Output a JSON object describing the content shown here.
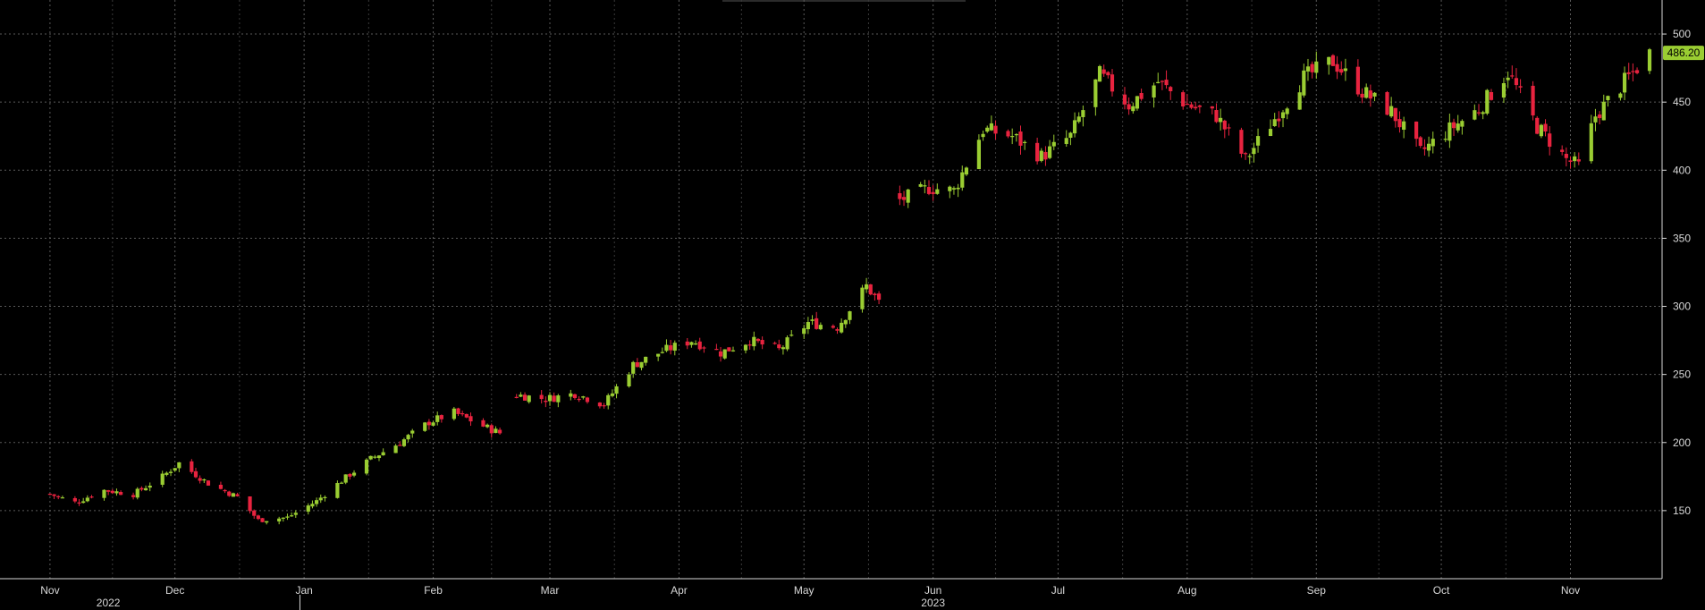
{
  "chart_data": {
    "type": "candlestick",
    "title": "",
    "xlabel": "",
    "ylabel": "",
    "grid": true,
    "legend": "none",
    "ylim": [
      100,
      525
    ],
    "y_ticks": [
      150,
      200,
      250,
      300,
      350,
      400,
      450,
      500
    ],
    "x_month_labels": [
      {
        "label": "Nov",
        "date": "2022-11-01"
      },
      {
        "label": "Dec",
        "date": "2022-12-01"
      },
      {
        "label": "Jan",
        "date": "2023-01-01"
      },
      {
        "label": "Feb",
        "date": "2023-02-01"
      },
      {
        "label": "Mar",
        "date": "2023-03-01"
      },
      {
        "label": "Apr",
        "date": "2023-04-01"
      },
      {
        "label": "May",
        "date": "2023-05-01"
      },
      {
        "label": "Jun",
        "date": "2023-06-01"
      },
      {
        "label": "Jul",
        "date": "2023-07-01"
      },
      {
        "label": "Aug",
        "date": "2023-08-01"
      },
      {
        "label": "Sep",
        "date": "2023-09-01"
      },
      {
        "label": "Oct",
        "date": "2023-10-01"
      },
      {
        "label": "Nov",
        "date": "2023-11-01"
      }
    ],
    "x_year_labels": [
      {
        "label": "2022",
        "date": "2022-11-15"
      },
      {
        "label": "2023",
        "date": "2023-06-01"
      }
    ],
    "last_price": 486.2,
    "last_price_label": "486.20",
    "colors": {
      "up": "#9ACD32",
      "down": "#E8233F",
      "grid": "#5a5a5a",
      "axis_text": "#d8d8d8",
      "background": "#000000",
      "last_price_badge": "#9ACD32"
    },
    "anchors": [
      [
        "2022-11-01",
        162
      ],
      [
        "2022-11-07",
        156
      ],
      [
        "2022-11-14",
        165
      ],
      [
        "2022-11-21",
        162
      ],
      [
        "2022-11-28",
        175
      ],
      [
        "2022-12-02",
        185
      ],
      [
        "2022-12-09",
        170
      ],
      [
        "2022-12-16",
        160
      ],
      [
        "2022-12-21",
        143
      ],
      [
        "2022-12-28",
        145
      ],
      [
        "2023-01-04",
        157
      ],
      [
        "2023-01-10",
        172
      ],
      [
        "2023-01-17",
        188
      ],
      [
        "2023-01-24",
        200
      ],
      [
        "2023-01-31",
        215
      ],
      [
        "2023-02-06",
        222
      ],
      [
        "2023-02-13",
        212
      ],
      [
        "2023-02-17",
        207
      ],
      [
        "2023-02-21",
        235
      ],
      [
        "2023-02-28",
        232
      ],
      [
        "2023-03-07",
        236
      ],
      [
        "2023-03-14",
        228
      ],
      [
        "2023-03-21",
        257
      ],
      [
        "2023-03-28",
        267
      ],
      [
        "2023-04-04",
        275
      ],
      [
        "2023-04-11",
        266
      ],
      [
        "2023-04-18",
        275
      ],
      [
        "2023-04-25",
        268
      ],
      [
        "2023-05-02",
        288
      ],
      [
        "2023-05-09",
        285
      ],
      [
        "2023-05-16",
        315
      ],
      [
        "2023-05-19",
        303
      ],
      [
        "2023-05-24",
        378
      ],
      [
        "2023-05-31",
        387
      ],
      [
        "2023-06-06",
        385
      ],
      [
        "2023-06-13",
        430
      ],
      [
        "2023-06-20",
        425
      ],
      [
        "2023-06-27",
        410
      ],
      [
        "2023-07-04",
        425
      ],
      [
        "2023-07-11",
        470
      ],
      [
        "2023-07-18",
        448
      ],
      [
        "2023-07-25",
        465
      ],
      [
        "2023-08-01",
        448
      ],
      [
        "2023-08-08",
        440
      ],
      [
        "2023-08-15",
        408
      ],
      [
        "2023-08-22",
        438
      ],
      [
        "2023-08-29",
        468
      ],
      [
        "2023-09-05",
        480
      ],
      [
        "2023-09-12",
        458
      ],
      [
        "2023-09-19",
        443
      ],
      [
        "2023-09-26",
        413
      ],
      [
        "2023-10-03",
        430
      ],
      [
        "2023-10-10",
        445
      ],
      [
        "2023-10-17",
        472
      ],
      [
        "2023-10-24",
        432
      ],
      [
        "2023-10-31",
        408
      ],
      [
        "2023-11-03",
        403
      ],
      [
        "2023-11-07",
        440
      ],
      [
        "2023-11-14",
        465
      ],
      [
        "2023-11-20",
        486
      ]
    ],
    "gaps": [
      [
        "2023-02-17",
        "2023-02-21"
      ],
      [
        "2023-05-19",
        "2023-05-24"
      ]
    ]
  }
}
